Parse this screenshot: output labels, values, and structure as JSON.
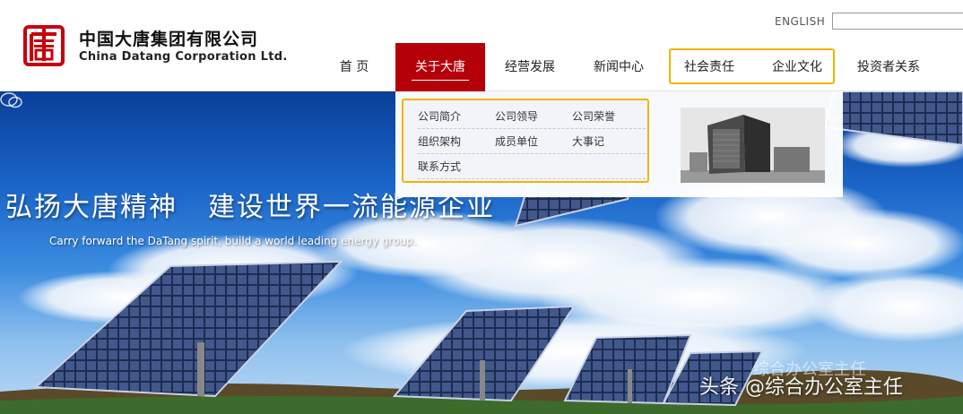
{
  "brand": {
    "name_cn": "中国大唐集团有限公司",
    "name_en": "China Datang Corporation Ltd.",
    "logo_icon": "datang-seal-icon",
    "brand_color": "#c8000b"
  },
  "header": {
    "language_link": "ENGLISH",
    "search_placeholder": ""
  },
  "nav": {
    "items": [
      {
        "label": "首  页"
      },
      {
        "label": "关于大唐",
        "active": true
      },
      {
        "label": "经营发展"
      },
      {
        "label": "新闻中心"
      },
      {
        "label": "社会责任"
      },
      {
        "label": "企业文化"
      },
      {
        "label": "投资者关系"
      }
    ],
    "active_color": "#b5000a",
    "highlight_color": "#f0b400"
  },
  "dropdown": {
    "links": [
      "公司简介",
      "公司领导",
      "公司荣誉",
      "组织架构",
      "成员单位",
      "大事记",
      "联系方式"
    ],
    "photo_alt": "headquarters-building-photo"
  },
  "hero": {
    "title_part1": "弘扬大唐精神",
    "title_part2": "建设世界一流能源企业",
    "subtitle": "Carry forward the DaTang spirit,  build a world leading energy group."
  },
  "watermark": {
    "text": "头条 @综合办公室主任",
    "faint_text": "综合办公室主任",
    "icon": "wechat-icon"
  }
}
